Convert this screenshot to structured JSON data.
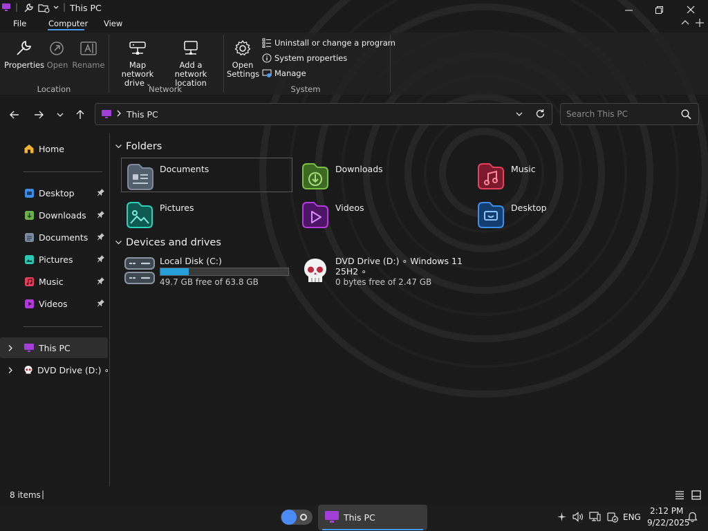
{
  "window": {
    "title": "This PC"
  },
  "menu": {
    "tabs": [
      {
        "label": "File"
      },
      {
        "label": "Computer"
      },
      {
        "label": "View"
      }
    ]
  },
  "ribbon": {
    "groups": {
      "location": "Location",
      "network": "Network",
      "system": "System"
    },
    "buttons": {
      "properties": "Properties",
      "open": "Open",
      "rename": "Rename",
      "map_network_drive_l1": "Map network",
      "map_network_drive_l2": "drive",
      "add_network_location_l1": "Add a network",
      "add_network_location_l2": "location",
      "open_settings_l1": "Open",
      "open_settings_l2": "Settings",
      "uninstall": "Uninstall or change a program",
      "system_properties": "System properties",
      "manage": "Manage"
    }
  },
  "navigation": {
    "breadcrumb": "This PC",
    "search_placeholder": "Search This PC"
  },
  "sidebar": {
    "home": "Home",
    "pinned": [
      {
        "label": "Desktop",
        "color": "#3d8de8"
      },
      {
        "label": "Downloads",
        "color": "#6ab04c"
      },
      {
        "label": "Documents",
        "color": "#7a8aa0"
      },
      {
        "label": "Pictures",
        "color": "#29c7b4"
      },
      {
        "label": "Music",
        "color": "#e8405a"
      },
      {
        "label": "Videos",
        "color": "#b03adb"
      }
    ],
    "this_pc": "This PC",
    "dvd_drive": "DVD Drive (D:) ∘ W"
  },
  "content": {
    "folders_heading": "Folders",
    "folders": [
      {
        "name": "Documents",
        "color": "#7f8b9a"
      },
      {
        "name": "Downloads",
        "color": "#7ac143"
      },
      {
        "name": "Music",
        "color": "#e8405a"
      },
      {
        "name": "Pictures",
        "color": "#2ad1bb"
      },
      {
        "name": "Videos",
        "color": "#b43be0"
      },
      {
        "name": "Desktop",
        "color": "#3a90ea"
      }
    ],
    "drives_heading": "Devices and drives",
    "drives": {
      "local_disk": {
        "name": "Local Disk (C:)",
        "free_text": "49.7 GB free of 63.8 GB",
        "used_fraction": 0.221
      },
      "dvd": {
        "name_l1": "DVD Drive (D:) ∘ Windows 11",
        "name_l2": "25H2 ∘",
        "free_text": "0 bytes free of 2.47 GB"
      }
    }
  },
  "status": {
    "items_count": "8 items"
  },
  "taskbar": {
    "app_label": "This PC",
    "language": "ENG",
    "time": "2:12 PM",
    "date": "9/22/2025",
    "accent": "#4a9cf0"
  }
}
